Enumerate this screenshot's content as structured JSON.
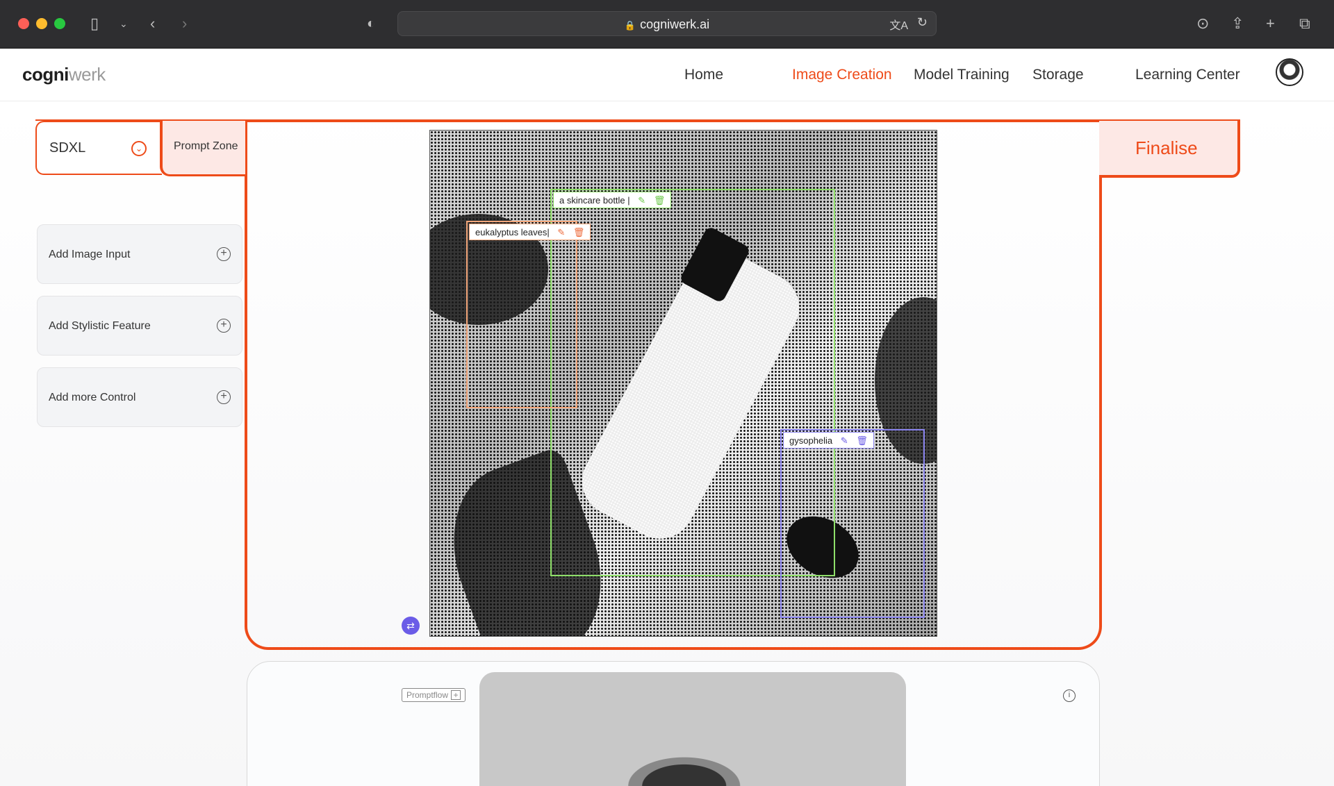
{
  "browser": {
    "url": "cogniwerk.ai"
  },
  "logo": {
    "bold": "cogni",
    "light": "werk"
  },
  "nav": {
    "items": [
      {
        "label": "Home"
      },
      {
        "label": "Image Creation"
      },
      {
        "label": "Model Training"
      },
      {
        "label": "Storage"
      },
      {
        "label": "Learning Center"
      }
    ],
    "active": "Image Creation"
  },
  "model": {
    "selected": "SDXL"
  },
  "prompt_zone": {
    "label": "Prompt Zone"
  },
  "finalise": {
    "label": "Finalise"
  },
  "sidebar": {
    "cards": [
      {
        "label": "Add Image Input"
      },
      {
        "label": "Add Stylistic Feature"
      },
      {
        "label": "Add more Control"
      }
    ]
  },
  "regions": [
    {
      "label": "a skincare bottle |",
      "color": "#8fe06a"
    },
    {
      "label": "eukalyptus leaves|",
      "color": "#f3a67a"
    },
    {
      "label": "gysophelia",
      "color": "#8b85f0"
    }
  ],
  "bottom": {
    "promptflow_label": "Promptflow"
  },
  "colors": {
    "accent": "#ee4b19",
    "accent_light": "#fde8e5"
  }
}
